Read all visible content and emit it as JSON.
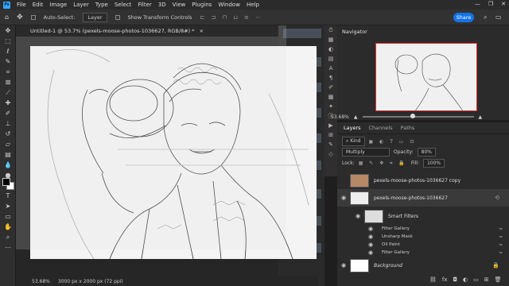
{
  "menu": [
    "File",
    "Edit",
    "Image",
    "Layer",
    "Type",
    "Select",
    "Filter",
    "3D",
    "View",
    "Plugins",
    "Window",
    "Help"
  ],
  "logo_text": "Ps",
  "window_controls": [
    "—",
    "❐",
    "✕"
  ],
  "options": {
    "auto_select": "Auto-Select:",
    "layer_dropdown": "Layer",
    "show_transform": "Show Transform Controls",
    "share": "Share"
  },
  "document": {
    "tab_title": "Untitled-1 @ 53.7% (pexels-moose-photos-1036627, RGB/8#) *",
    "tab_close": "×"
  },
  "status": {
    "zoom": "53.68%",
    "size": "3000 px x 2000 px (72 ppi)"
  },
  "navigator": {
    "title": "Navigator",
    "zoom": "53.68%"
  },
  "layers": {
    "tabs": [
      "Layers",
      "Channels",
      "Paths"
    ],
    "kind": "Kind",
    "blend_mode": "Multiply",
    "opacity_label": "Opacity:",
    "opacity_value": "80%",
    "lock_label": "Lock:",
    "fill_label": "Fill:",
    "fill_value": "100%",
    "items": [
      {
        "name": "pexels-moose-photos-1036627 copy"
      },
      {
        "name": "pexels-moose-photos-1036627"
      }
    ],
    "smart_filters_label": "Smart Filters",
    "filters": [
      "Filter Gallery",
      "Unsharp Mask",
      "Oil Paint",
      "Filter Gallery"
    ],
    "background": "Background"
  },
  "icons": {
    "move": "move-icon",
    "eye": "eye-icon",
    "lock": "lock-icon",
    "filter": "filter-settings-icon"
  }
}
